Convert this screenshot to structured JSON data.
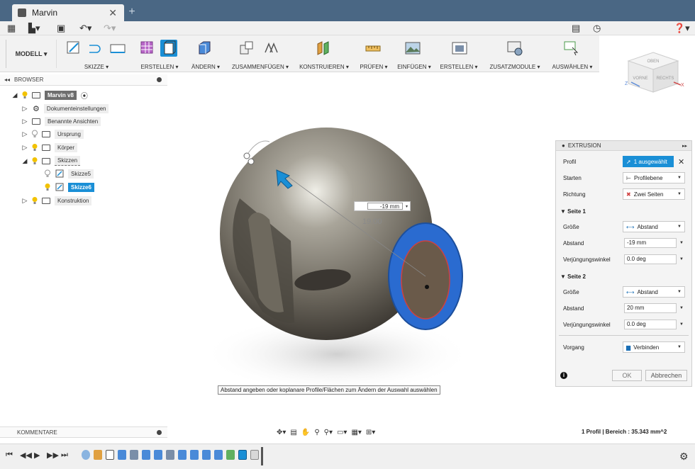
{
  "window": {
    "tab_title": "Marvin",
    "close": "✕",
    "new_tab": "+"
  },
  "ribbon": {
    "workspace": "MODELL ▾",
    "groups": [
      "SKIZZE ▾",
      "ERSTELLEN ▾",
      "ÄNDERN ▾",
      "ZUSAMMENFÜGEN ▾",
      "KONSTRUIEREN ▾",
      "PRÜFEN ▾",
      "EINFÜGEN ▾",
      "ERSTELLEN ▾",
      "ZUSATZMODULE ▾",
      "AUSWÄHLEN ▾"
    ]
  },
  "viewcube": {
    "top": "OBEN",
    "front": "VORNE",
    "right": "RECHTS",
    "axis_x": "X",
    "axis_z": "Z"
  },
  "browser": {
    "title": "BROWSER",
    "items": [
      {
        "label": "Marvin v8"
      },
      {
        "label": "Dokumenteinstellungen"
      },
      {
        "label": "Benannte Ansichten"
      },
      {
        "label": "Ursprung"
      },
      {
        "label": "Körper"
      },
      {
        "label": "Skizzen"
      },
      {
        "label": "Skizze5"
      },
      {
        "label": "Skizze6"
      },
      {
        "label": "Konstruktion"
      }
    ]
  },
  "viewport": {
    "dimension_input": "-19 mm",
    "dimension_label": "19.00",
    "hint": "Abstand angeben oder koplanare Profile/Flächen zum Ändern der Auswahl auswählen"
  },
  "extrusion": {
    "title": "EXTRUSION",
    "profil_label": "Profil",
    "profil_value": "1 ausgewählt",
    "starten_label": "Starten",
    "starten_value": "Profilebene",
    "richtung_label": "Richtung",
    "richtung_value": "Zwei Seiten",
    "seite1": "Seite 1",
    "seite2": "Seite 2",
    "groesse_label": "Größe",
    "groesse_value": "Abstand",
    "abstand_label": "Abstand",
    "abstand1": "-19 mm",
    "abstand2": "20 mm",
    "verjuengung_label": "Verjüngungswinkel",
    "verjuengung1": "0.0 deg",
    "verjuengung2": "0.0 deg",
    "vorgang_label": "Vorgang",
    "vorgang_value": "Verbinden",
    "ok": "OK",
    "cancel": "Abbrechen",
    "info": "i"
  },
  "comments": {
    "title": "KOMMENTARE"
  },
  "status": {
    "text": "1 Profil | Bereich : 35.343 mm^2"
  },
  "colors": {
    "titlebar": "#4a6784",
    "accent": "#1a8fd6",
    "face_highlight": "#2a6bd0"
  }
}
